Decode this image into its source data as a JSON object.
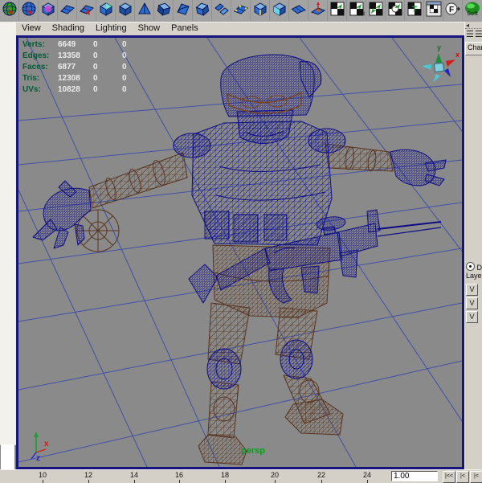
{
  "shelf": {
    "icons": [
      "nurbs-sphere-green",
      "poly-sphere",
      "subdiv-proxy-cube",
      "poly-plane",
      "poly-plane-select",
      "poly-cube",
      "poly-prism",
      "poly-pyramid",
      "poly-cube-dark",
      "poly-cube-open",
      "poly-cube-flat",
      "poly-plane-pair",
      "poly-vertices",
      "poly-edges",
      "poly-face",
      "poly-plane-tilt",
      "poly-extrude-axis",
      "uv-checker-map",
      "uv-checker-assign",
      "uv-checker-cut",
      "uv-checker-circle",
      "uv-checker-text",
      "uv-checker-window",
      "history-f",
      "soft-mod"
    ],
    "soft_label": "Soft"
  },
  "menu_bar": {
    "items": [
      "View",
      "Shading",
      "Lighting",
      "Show",
      "Panels"
    ]
  },
  "hud": {
    "rows": [
      {
        "label": "Verts:",
        "value": "6649",
        "sel": "0",
        "extra": "0"
      },
      {
        "label": "Edges:",
        "value": "13358",
        "sel": "0",
        "extra": "0"
      },
      {
        "label": "Faces:",
        "value": "6877",
        "sel": "0",
        "extra": "0"
      },
      {
        "label": "Tris:",
        "value": "12308",
        "sel": "0",
        "extra": "0"
      },
      {
        "label": "UVs:",
        "value": "10828",
        "sel": "0",
        "extra": "0"
      }
    ]
  },
  "viewport": {
    "camera_label": "persp",
    "compass": {
      "x": "x",
      "y": "y"
    },
    "axis_gizmo": {
      "x": "x",
      "z": "z"
    },
    "background": "#8a8a8a",
    "grid_color": "#3e4ea8",
    "model_colors": {
      "upper_body_wire": "#0e0e8a",
      "lower_body_wire": "#5c3a22"
    }
  },
  "right_panel": {
    "tab": "Chan",
    "display_radio": "D",
    "layers_label": "Laye",
    "layer_rows": [
      "V",
      "V",
      "V"
    ]
  },
  "timeline": {
    "ticks": [
      "10",
      "12",
      "14",
      "16",
      "18",
      "20",
      "22",
      "24"
    ],
    "current_frame": "1.00",
    "playback": [
      "|<<",
      "|<",
      "|<"
    ]
  }
}
